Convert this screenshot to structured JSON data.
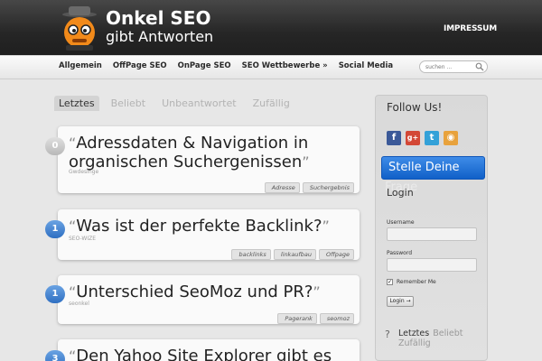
{
  "header": {
    "brand_line1": "Onkel SEO",
    "brand_line2": "gibt Antworten",
    "impressum": "IMPRESSUM"
  },
  "nav": {
    "items": [
      "Allgemein",
      "OffPage SEO",
      "OnPage SEO",
      "SEO Wettbewerbe »",
      "Social Media"
    ],
    "search_placeholder": "suchen ..."
  },
  "content_tabs": [
    "Letztes",
    "Beliebt",
    "Unbeantwortet",
    "Zufällig"
  ],
  "questions": [
    {
      "count": "0",
      "title": "Adressdaten & Navigation in organischen Suchergenissen",
      "author": "Gwdesinge",
      "tags": [
        "Adresse",
        "Suchergebnis"
      ]
    },
    {
      "count": "1",
      "title": "Was ist der perfekte Backlink?",
      "author": "SEO-WIZE",
      "tags": [
        "backlinks",
        "linkaufbau",
        "Offpage"
      ]
    },
    {
      "count": "1",
      "title": "Unterschied SeoMoz und PR?",
      "author": "seonkel",
      "tags": [
        "Pagerank",
        "seomoz"
      ]
    },
    {
      "count": "3",
      "title": "Den Yahoo Site Explorer gibt es",
      "author": "",
      "tags": []
    }
  ],
  "quote_open": "“",
  "quote_close": "”",
  "sidebar": {
    "follow_title": "Follow Us!",
    "social": [
      {
        "icon": "facebook-icon",
        "glyph": "f",
        "color": "#3b5998"
      },
      {
        "icon": "googleplus-icon",
        "glyph": "g+",
        "color": "#d34836"
      },
      {
        "icon": "twitter-icon",
        "glyph": "t",
        "color": "#33a1d8"
      },
      {
        "icon": "rss-icon",
        "glyph": "◉",
        "color": "#e8a23c"
      }
    ],
    "ask_button": "Stelle Deine",
    "ask_button_overflow": "Frage",
    "login_title": "Login",
    "username_label": "Username",
    "password_label": "Password",
    "remember_label": "Remember Me",
    "login_button": "Login →",
    "tabs": {
      "question_icon": "?",
      "letztes": "Letztes",
      "beliebt": "Beliebt",
      "zufaellig": "Zufällig"
    }
  },
  "colors": {
    "accent_blue": "#2e6fc2",
    "header_dark": "#262626"
  }
}
